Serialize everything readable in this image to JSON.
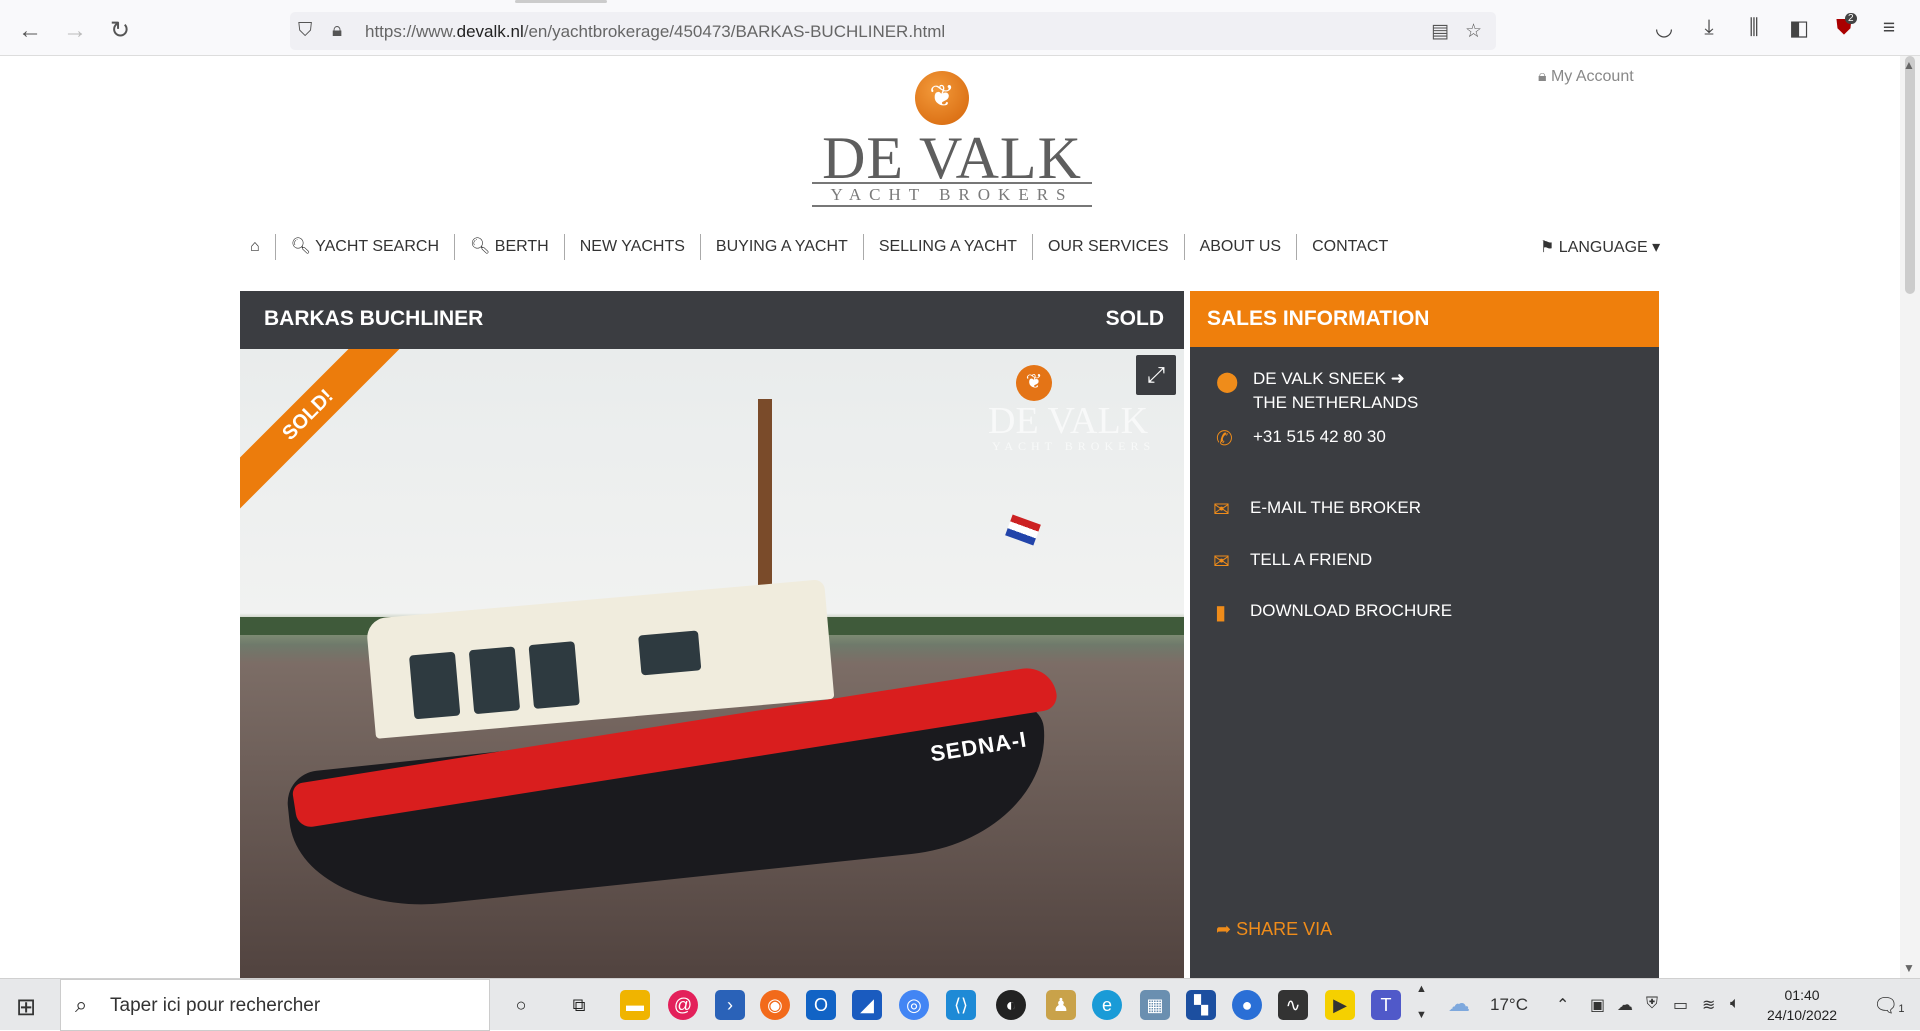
{
  "browser": {
    "url_prefix": "https://www.",
    "url_domain": "devalk.nl",
    "url_path": "/en/yachtbrokerage/450473/BARKAS-BUCHLINER.html"
  },
  "site": {
    "account_label": "My Account",
    "logo_name": "DE VALK",
    "logo_tagline": "YACHT BROKERS"
  },
  "nav": {
    "items": [
      "YACHT SEARCH",
      "BERTH",
      "NEW YACHTS",
      "BUYING A YACHT",
      "SELLING A YACHT",
      "OUR SERVICES",
      "ABOUT US",
      "CONTACT"
    ],
    "language_label": "LANGUAGE"
  },
  "listing": {
    "title": "BARKAS BUCHLINER",
    "status": "SOLD",
    "ribbon": "SOLD!",
    "boat_name": "SEDNA-I"
  },
  "sales": {
    "heading": "SALES INFORMATION",
    "office": "DE VALK SNEEK",
    "country": "THE NETHERLANDS",
    "phone": "+31 515 42 80 30",
    "email_label": "E-MAIL THE BROKER",
    "friend_label": "TELL A FRIEND",
    "brochure_label": "DOWNLOAD BROCHURE",
    "share_label": "SHARE VIA"
  },
  "taskbar": {
    "search_placeholder": "Taper ici pour rechercher",
    "weather": "17°C",
    "time": "01:40",
    "date": "24/10/2022",
    "notification_count": "1"
  },
  "colors": {
    "accent": "#ef7f0c",
    "dark_panel": "#3b3d41"
  }
}
